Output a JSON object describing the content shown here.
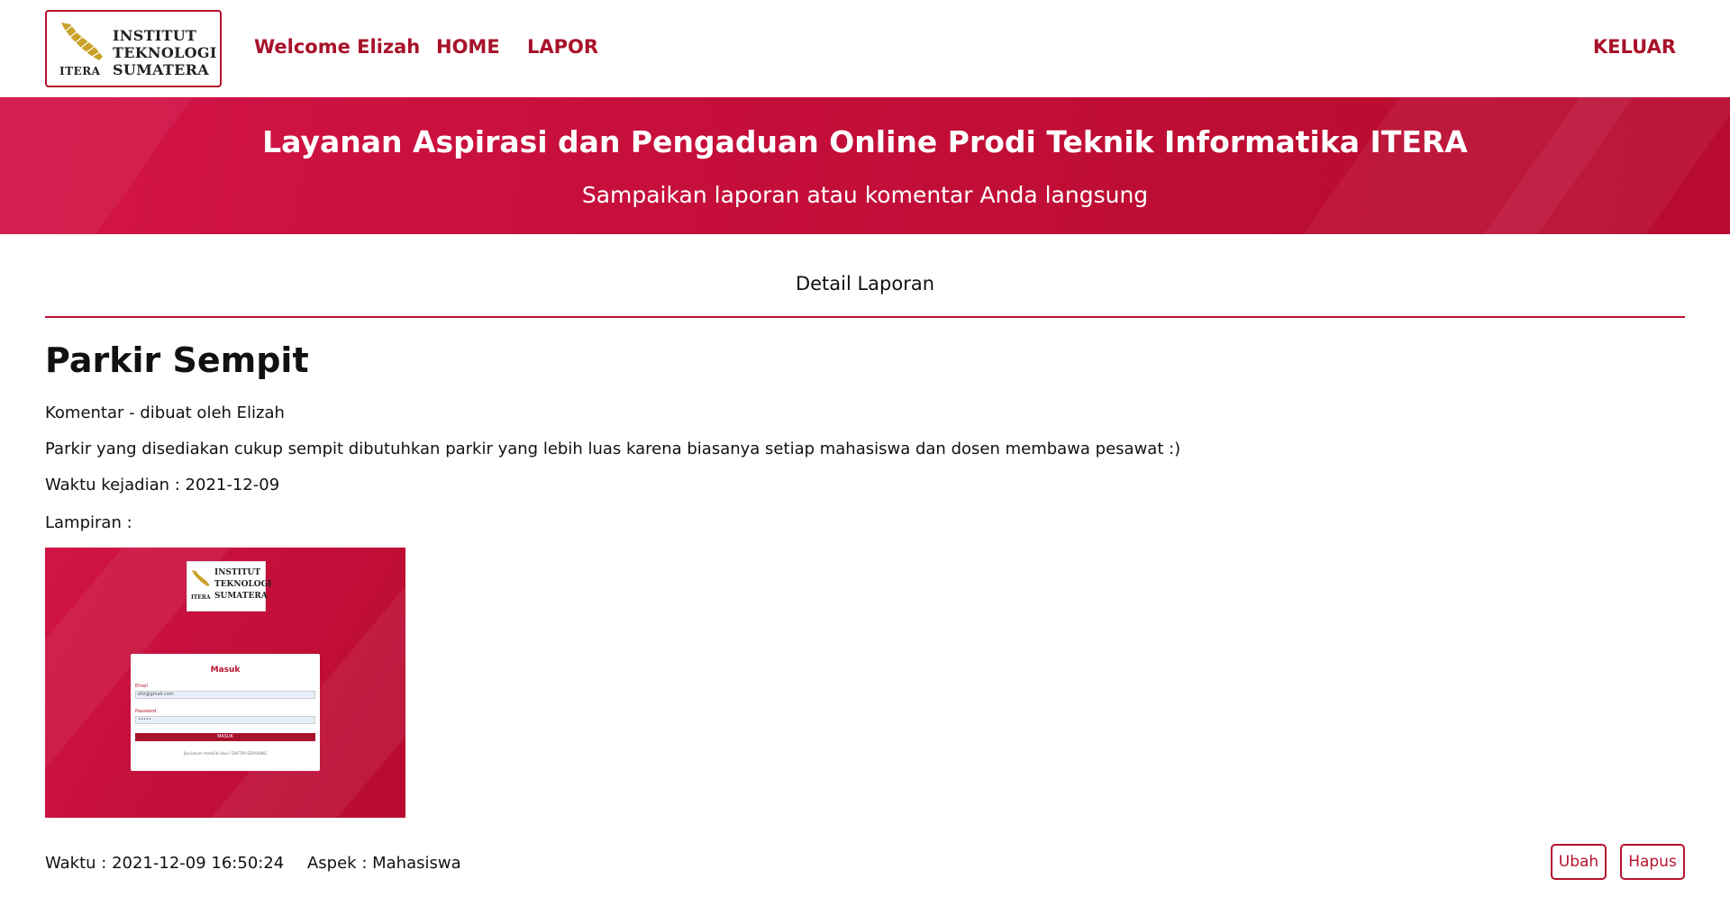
{
  "navbar": {
    "logo": {
      "line1": "INSTITUT",
      "line2": "TEKNOLOGI",
      "line3": "SUMATERA",
      "abbr": "ITERA"
    },
    "welcome": "Welcome Elizah",
    "home": "HOME",
    "lapor": "LAPOR",
    "keluar": "KELUAR"
  },
  "hero": {
    "title": "Layanan Aspirasi dan Pengaduan Online Prodi Teknik Informatika ITERA",
    "subtitle": "Sampaikan laporan atau komentar Anda langsung"
  },
  "page": {
    "section_title": "Detail Laporan"
  },
  "report": {
    "title": "Parkir Sempit",
    "meta": "Komentar - dibuat oleh Elizah",
    "description": "Parkir yang disediakan cukup sempit dibutuhkan parkir yang lebih luas karena biasanya setiap mahasiswa dan dosen membawa pesawat :)",
    "incident_time": "Waktu kejadian : 2021-12-09",
    "attachment_label": "Lampiran :",
    "attachment": {
      "logo_line1": "INSTITUT",
      "logo_line2": "TEKNOLOGI",
      "logo_line3": "SUMATERA",
      "logo_abbr": "ITERA",
      "card_title": "Masuk",
      "email_label": "Email",
      "email_value": "eliz@gmail.com",
      "password_label": "Password",
      "password_value": "•••••",
      "button_label": "MASUK",
      "footnote": "Jika belum memiliki akun? DAFTAR SEKARANG"
    },
    "time": "Waktu : 2021-12-09 16:50:24",
    "aspect": "Aspek : Mahasiswa"
  },
  "actions": {
    "edit": "Ubah",
    "delete": "Hapus"
  },
  "colors": {
    "accent": "#b5122c",
    "hero": "#c70f3c"
  },
  "icons": {
    "logo": "itera-logo-icon"
  }
}
